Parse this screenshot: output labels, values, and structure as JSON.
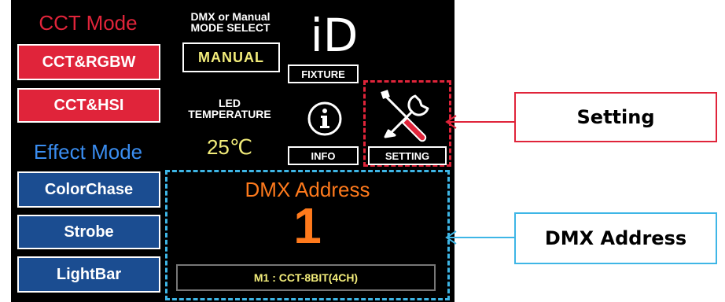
{
  "cct_mode": {
    "title": "CCT Mode",
    "buttons": [
      "CCT&RGBW",
      "CCT&HSI"
    ]
  },
  "effect_mode": {
    "title": "Effect Mode",
    "buttons": [
      "ColorChase",
      "Strobe",
      "LightBar"
    ]
  },
  "mode_select": {
    "label_line1": "DMX or Manual",
    "label_line2": "MODE SELECT",
    "value": "MANUAL"
  },
  "fixture": {
    "icon_text": "iD",
    "label": "FIXTURE"
  },
  "led_temperature": {
    "label_line1": "LED",
    "label_line2": "TEMPERATURE",
    "value": "25℃"
  },
  "info": {
    "label": "INFO"
  },
  "setting": {
    "label": "SETTING"
  },
  "dmx": {
    "title": "DMX Address",
    "value": "1",
    "mode": "M1 : CCT-8BIT(4CH)"
  },
  "callouts": {
    "setting": "Setting",
    "dmx_address": "DMX Address"
  },
  "colors": {
    "red": "#e0243a",
    "blue": "#1b4d91",
    "orange": "#ff7a1c",
    "yellow": "#f2ec7a",
    "cyan": "#3eb6e6"
  }
}
